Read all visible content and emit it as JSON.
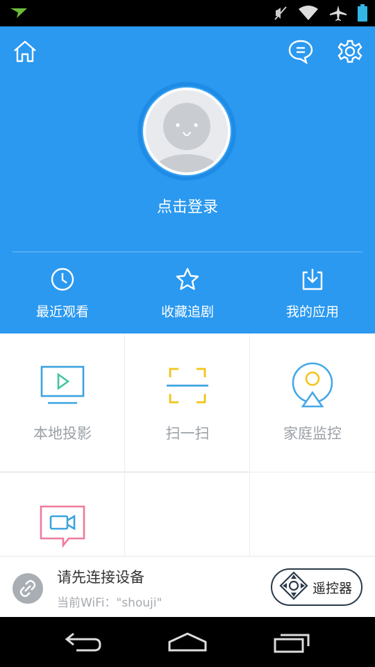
{
  "status_bar": {
    "icons": [
      "notification-plane-icon",
      "mute-icon",
      "wifi-icon",
      "airplane-mode-icon",
      "battery-icon"
    ]
  },
  "header": {
    "login_text": "点击登录",
    "quick_actions": [
      {
        "label": "最近观看",
        "icon": "clock-icon"
      },
      {
        "label": "收藏追剧",
        "icon": "star-icon"
      },
      {
        "label": "我的应用",
        "icon": "download-icon"
      }
    ]
  },
  "grid": {
    "items": [
      {
        "label": "本地投影",
        "icon": "tv-play-icon"
      },
      {
        "label": "扫一扫",
        "icon": "scan-icon"
      },
      {
        "label": "家庭监控",
        "icon": "camera-monitor-icon"
      },
      {
        "label": "",
        "icon": "video-chat-icon"
      }
    ]
  },
  "connection": {
    "title": "请先连接设备",
    "subtitle": "当前WiFi：\"shouji\"",
    "remote_label": "遥控器"
  },
  "colors": {
    "brand_blue": "#2b99f0",
    "tv_icon": "#3aa3e0",
    "scan_icon": "#f2c418",
    "monitor_ring": "#45a8e8",
    "video_icon": "#f07a9a"
  }
}
